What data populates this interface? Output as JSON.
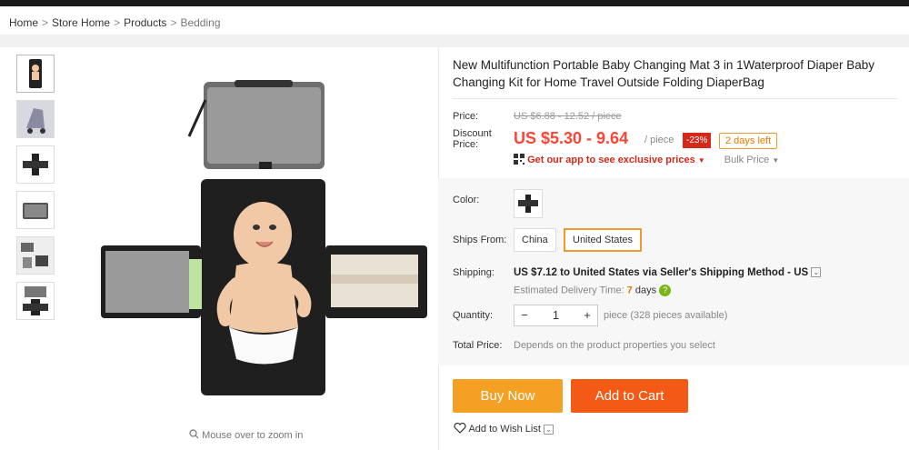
{
  "breadcrumb": [
    "Home",
    "Store Home",
    "Products",
    "Bedding"
  ],
  "gallery": {
    "thumbnails": [
      "thumb-1",
      "thumb-2",
      "thumb-3",
      "thumb-4",
      "thumb-5",
      "thumb-6"
    ],
    "zoom_hint": "Mouse over to zoom in"
  },
  "product": {
    "title": "New Multifunction Portable Baby Changing Mat 3 in 1Waterproof Diaper Baby Changing Kit for Home Travel Outside Folding DiaperBag",
    "price_label": "Price:",
    "old_price": "US $6.88 - 12.52 / piece",
    "discount_label": "Discount Price:",
    "price": "US $5.30 - 9.64",
    "per_piece": "/ piece",
    "discount_badge": "-23%",
    "days_left": "2 days left",
    "app_promo": "Get our app to see exclusive prices",
    "bulk_price": "Bulk Price",
    "color_label": "Color:",
    "ships_from_label": "Ships From:",
    "ships_from_options": [
      "China",
      "United States"
    ],
    "ships_from_selected": "United States",
    "shipping_label": "Shipping:",
    "shipping_cost": "US $7.12",
    "shipping_text": "to United States via Seller's Shipping Method - US",
    "delivery_label": "Estimated Delivery Time:",
    "delivery_days": "7",
    "delivery_unit": "days",
    "quantity_label": "Quantity:",
    "quantity_value": "1",
    "quantity_minus": "−",
    "quantity_plus": "+",
    "quantity_available": "piece (328 pieces available)",
    "total_label": "Total Price:",
    "total_text": "Depends on the product properties you select",
    "buy_now": "Buy Now",
    "add_to_cart": "Add to Cart",
    "wish_list": "Add to Wish List"
  },
  "colors": {
    "price_red": "#ff4433",
    "buy_now_bg": "#f4a025",
    "add_cart_bg": "#f25a16",
    "selected_border": "#f09a2b"
  }
}
